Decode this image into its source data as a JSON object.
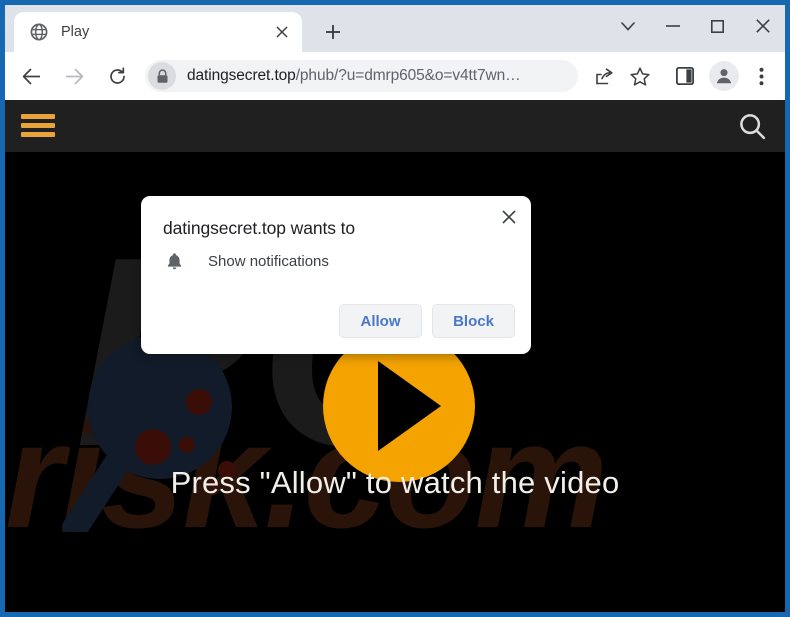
{
  "browser": {
    "tab": {
      "title": "Play",
      "favicon": "globe-icon",
      "close_label": "×"
    },
    "new_tab_label": "+",
    "window_controls": {
      "tab_search": "tab-search-chevron-icon",
      "minimize": "minimize-icon",
      "maximize": "maximize-icon",
      "close": "close-icon"
    },
    "nav": {
      "back": "back-arrow-icon",
      "forward": "forward-arrow-icon",
      "reload": "reload-icon"
    },
    "omnibox": {
      "lock": "lock-icon",
      "url_domain": "datingsecret.top",
      "url_path": "/phub/?u=dmrp605&o=v4tt7wn…",
      "full_url": "datingsecret.top/phub/?u=dmrp605&o=v4tt7wn…"
    },
    "toolbar_icons": {
      "share": "share-icon",
      "bookmark": "star-icon",
      "side_panel": "side-panel-icon",
      "profile": "profile-avatar-icon",
      "menu": "three-dot-menu-icon"
    },
    "colors": {
      "window_frame": "#1668b0",
      "tabstrip": "#dee3ea",
      "toolbar": "#ffffff",
      "omnibox": "#f1f3f4"
    }
  },
  "permission_dialog": {
    "title": "datingsecret.top wants to",
    "permission_icon": "bell-icon",
    "permission_label": "Show notifications",
    "allow_label": "Allow",
    "block_label": "Block",
    "close_label": "×",
    "button_text_color": "#4a77c8"
  },
  "page": {
    "header": {
      "menu_icon": "hamburger-menu-icon",
      "search_icon": "search-icon",
      "menu_color": "#e8a33d",
      "background": "#202020"
    },
    "play_button": {
      "icon": "play-button-icon",
      "circle_color": "#f5a300",
      "triangle_color": "#000000"
    },
    "headline": "Press \"Allow\" to watch the video",
    "background_color": "#000000",
    "decorations": {
      "magnifier_icon": "magnifier-decoration-icon",
      "magnifier_color": "#101a28",
      "dot_color": "#3a0d06"
    },
    "watermark": {
      "line1": "PC",
      "line2": "risk.com",
      "color_top": "#1b1b1b",
      "color_bottom": "#2a1409"
    }
  }
}
